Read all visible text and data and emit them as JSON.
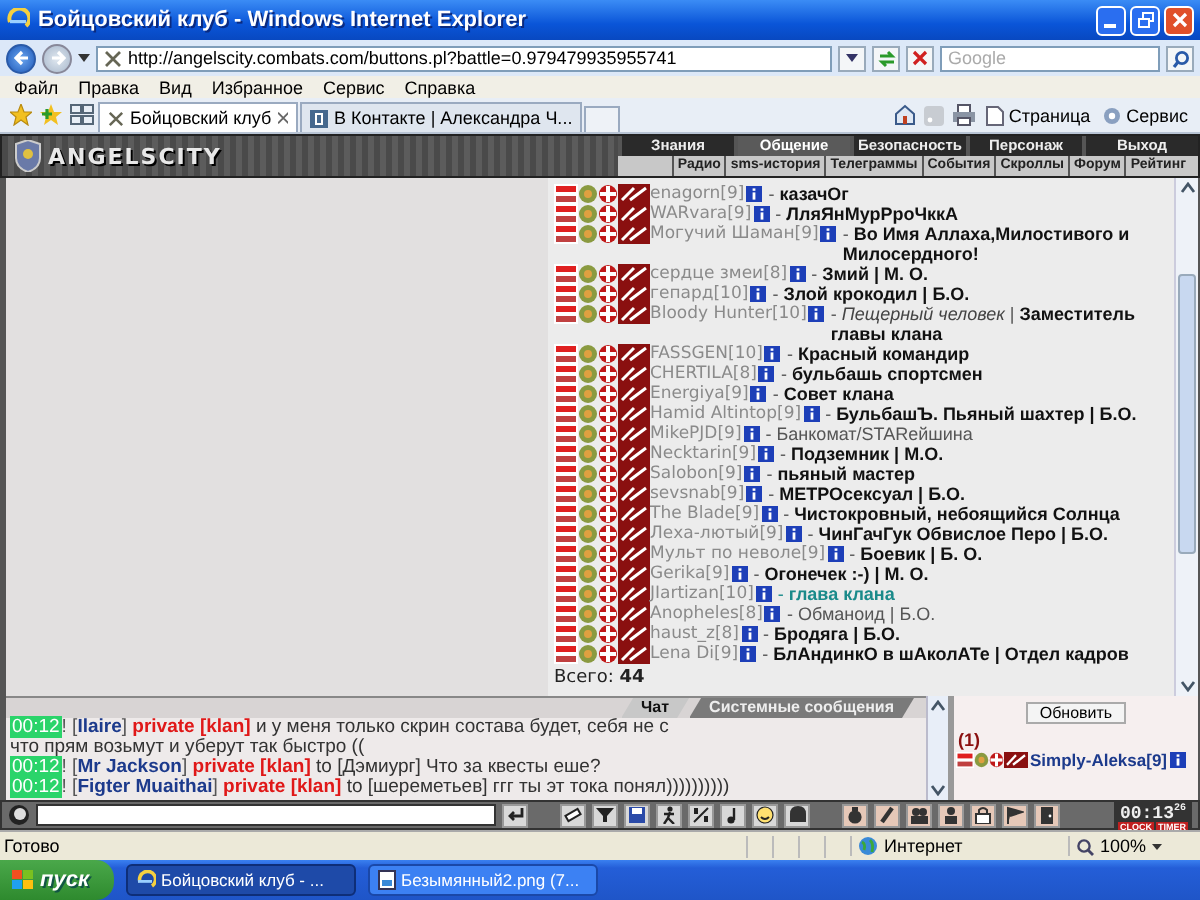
{
  "window": {
    "title": "Бойцовский клуб - Windows Internet Explorer"
  },
  "address_bar": {
    "url": "http://angelscity.combats.com/buttons.pl?battle=0.979479935955741",
    "search_placeholder": "Google"
  },
  "menu": [
    "Файл",
    "Правка",
    "Вид",
    "Избранное",
    "Сервис",
    "Справка"
  ],
  "browser_tabs": [
    {
      "label": "Бойцовский клуб",
      "selected": true
    },
    {
      "label": "В Контакте | Александра Ч...",
      "selected": false
    }
  ],
  "command_bar": [
    "Страница",
    "Сервис"
  ],
  "game": {
    "logo": "ANGELSCITY",
    "nav": [
      {
        "label": "Знания",
        "selected": false
      },
      {
        "label": "Общение",
        "selected": true
      },
      {
        "label": "Безопасность",
        "selected": false
      },
      {
        "label": "Персонаж",
        "selected": false
      },
      {
        "label": "Выход",
        "selected": false
      }
    ],
    "subnav": [
      "Радио",
      "sms-история",
      "Телеграммы",
      "События",
      "Скроллы",
      "Форум",
      "Рейтинг"
    ]
  },
  "members": [
    {
      "name": "enagorn[9]",
      "status": "- **казачОг**",
      "highlight": false
    },
    {
      "name": "WARvara[9]",
      "status": "- **ЛляЯнМурРроЧккА**",
      "highlight": false
    },
    {
      "name": "Могучий Шаман[9]",
      "status": "- **Во Имя Аллаха,Милостивого и Милосердного!**",
      "highlight": false
    },
    {
      "name": "сердце змеи[8]",
      "status": "- **Змий | М. О.**",
      "highlight": false
    },
    {
      "name": "гепард[10]",
      "status": "- **Злой крокодил | Б.О.**",
      "highlight": false
    },
    {
      "name": "Bloody Hunter[10]",
      "status": "- *Пещерный человек* | **Заместитель главы клана**",
      "highlight": false
    },
    {
      "name": "FASSGEN[10]",
      "status": "- **Красный командир**",
      "highlight": false
    },
    {
      "name": "CHERTILA[8]",
      "status": "- **бульбашь спортсмен**",
      "highlight": false
    },
    {
      "name": "Energiya[9]",
      "status": "- **Совет клана**",
      "highlight": false
    },
    {
      "name": "Hamid Altintop[9]",
      "status": "- **БульбашЪ. Пьяный шахтер | Б.О.**",
      "highlight": false
    },
    {
      "name": "MikePJD[9]",
      "status": "- Банкомат/STARейшина",
      "highlight": false
    },
    {
      "name": "Necktarin[9]",
      "status": "- **Подземник | М.О.**",
      "highlight": false
    },
    {
      "name": "Salobon[9]",
      "status": "- **пьяный мастер**",
      "highlight": false
    },
    {
      "name": "sevsnab[9]",
      "status": "- **МЕТРОсексуал | Б.О.**",
      "highlight": false
    },
    {
      "name": "The Blade[9]",
      "status": "- **Чистокровный, небоящийся Солнца**",
      "highlight": false
    },
    {
      "name": "Леха-лютый[9]",
      "status": "- **ЧинГачГук Обвислое Перо | Б.О.**",
      "highlight": false
    },
    {
      "name": "Мульт по неволе[9]",
      "status": "- **Боевик | Б. О.**",
      "highlight": false
    },
    {
      "name": "Gerika[9]",
      "status": "- **Огонечек :-) | М. О.**",
      "highlight": false
    },
    {
      "name": "JIartizan[10]",
      "status": "- **глава клана**",
      "highlight": true
    },
    {
      "name": "Anopheles[8]",
      "status": "- Обманоид | Б.О.",
      "highlight": false
    },
    {
      "name": "haust_z[8]",
      "status": "- **Бродяга | Б.О.**",
      "highlight": false
    },
    {
      "name": "Lena Di[9]",
      "status": "- **БлАндинкО в шАколАТе | Отдел кадров**",
      "highlight": false
    }
  ],
  "total": {
    "label": "Всего:",
    "value": "44"
  },
  "chat_tabs": [
    {
      "label": "Чат",
      "selected": true
    },
    {
      "label": "Системные сообщения",
      "selected": false
    }
  ],
  "chat": [
    {
      "time": "00:12",
      "sender": "! [**Ilaire**]",
      "channel": "private [klan]",
      "lines": [
        "и у меня только скрин состава будет, себя не с",
        "что прям возьмут и уберут так быстро (("
      ]
    },
    {
      "time": "00:12",
      "sender": "! [**Mr Jackson**]",
      "channel": "private [klan]",
      "lines": [
        "to [Дэмиург] Что за квесты еше?"
      ]
    },
    {
      "time": "00:12",
      "sender": "! [**Figter Muaithai**]",
      "channel": "private [klan]",
      "lines": [
        "to [шереметьев] ггг ты эт тока понял))))))))))"
      ]
    }
  ],
  "side_panel": {
    "button": "Обновить",
    "count": "(1)",
    "user": "Simply-Aleksa[9]"
  },
  "toolbar": {
    "clock": "00:13",
    "seconds": "26",
    "clock_labels": [
      "CLOCK",
      "TIMER"
    ]
  },
  "status_bar": {
    "status": "Готово",
    "zone": "Интернет",
    "zoom": "100%"
  },
  "taskbar": {
    "start": "пуск",
    "items": [
      {
        "label": "Бойцовский клуб - ...",
        "selected": true
      },
      {
        "label": "Безымянный2.png (7...",
        "selected": false
      }
    ]
  }
}
